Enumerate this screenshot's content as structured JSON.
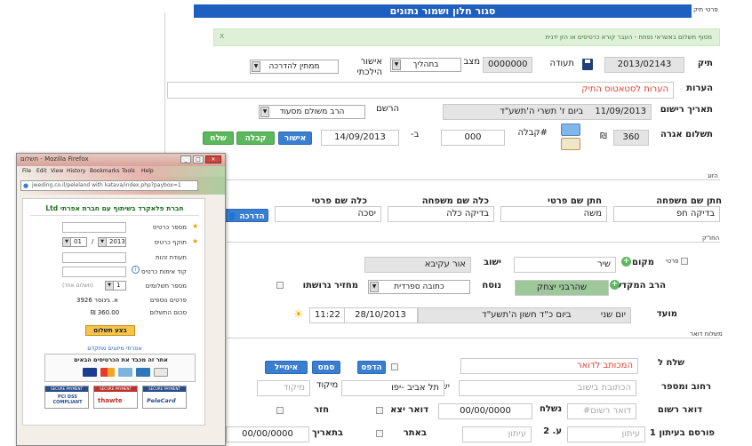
{
  "header": {
    "close_save_button": "סגור חלון ושמור נתונים"
  },
  "sections": {
    "file_details": "פרטי תיק",
    "hazmana": "הזוג",
    "hupa": "החו\"ק",
    "delivery": "משלוח דואר"
  },
  "notice": {
    "text": "מסוף תשלום באשראי נפתח - העבר קורא כרטיסים או הזן ידנית",
    "close": "x"
  },
  "file": {
    "tik_label": "תיק",
    "tik_value": "2013/02143",
    "teuda_label": "תעודה",
    "teuda_value": "0000000",
    "matzav_label": "מצב",
    "matzav_value": "בתהליך",
    "ishur_label": "אישור הילכתי",
    "ishur_value": "ממתין להדרכה",
    "notes_label": "הערות",
    "notes_value": "הערות לסטאטוס התיק",
    "reg_date_label": "תאריך רישום",
    "reg_date_value": "11/09/2013",
    "reg_date_hebrew": "ביום ז' תשרי ה'תשע\"ד",
    "registrar_label": "הרשם",
    "registrar_value": "הרב משולם מסעוד",
    "fee_label": "תשלום אגרה",
    "fee_value": "360",
    "currency": "₪",
    "receipt_label": "#קבלה",
    "receipt_value": "000",
    "on_label": "ב-",
    "on_value": "14/09/2013",
    "approve_button": "אישור",
    "receipt_button": "קבלה",
    "pay_button": "שלח"
  },
  "couple": {
    "groom_last_label": "חתן שם משפחה",
    "groom_last_value": "בדיקה חפ",
    "groom_first_label": "חתן שם פרטי",
    "groom_first_value": "משה",
    "bride_last_label": "כלה שם משפחה",
    "bride_last_value": "בדיקה כלה",
    "bride_first_label": "כלה שם פרטי",
    "bride_first_value": "יסכה",
    "guidance_button": "הדרכה"
  },
  "hupa": {
    "place_label": "מקום",
    "place_value": "שיר",
    "private_label": "פרטי",
    "settlement_label": "ישוב",
    "settlement_value": "אור עקיבא",
    "rabbi_label": "הרב המקדש",
    "rabbi_value": "שהרבני יצחק",
    "nusach_label": "נוסח",
    "nusach_value": "כתובה ספרדית",
    "divorcees_label": "מחזיר גרושתו",
    "date_label": "מועד",
    "day_value": "יום שני",
    "hebrew_date": "ביום כ\"ד חשון ה'תשע\"ד",
    "date_value": "28/10/2013",
    "time_value": "11:22"
  },
  "delivery": {
    "send_to_label": "שלח ל",
    "send_to_value": "המכותב לדואר",
    "print_button": "הדפס",
    "sms_button": "סמס",
    "email_button": "אימייל",
    "street_label": "רחוב ומספר",
    "street_placeholder": "הכתובת בישוב",
    "settlement_label": "ישוב",
    "settlement_value": "תל אביב -יפו",
    "zip_label": "מיקוד",
    "zip_placeholder": "מיקוד",
    "registered_label": "דואר רשום",
    "registered_placeholder": "דואר רשום#",
    "sent_label": "נשלח",
    "sent_value": "00/00/0000",
    "outgoing_label": "דואר יצא",
    "returned_label": "חזר",
    "published_label": "פורסם בעיתון 1",
    "newspaper_placeholder": "עיתון",
    "page_label": "ע. 2",
    "page_placeholder": "עיתון",
    "site_label": "באתר",
    "date_label": "בתאריך",
    "date_value": "00/00/0000"
  },
  "popup": {
    "window_title": "תשלום - Mozilla Firefox",
    "menu": [
      "File",
      "Edit",
      "View",
      "History",
      "Bookmarks",
      "Tools",
      "Help"
    ],
    "url": "jweding.co.il/peleland with katava/index.php?paybox=1",
    "company": "חברת פלאקרד בשיתוף עם חברת אפרתי Ltd",
    "card_number_label": "מספר כרטיס",
    "expiry_label": "תוקף כרטיס",
    "expiry_month": "01",
    "expiry_year": "2013",
    "expiry_sep": "/",
    "id_label": "תעודת זהות",
    "cvv_label": "קוד אימות כרטיס",
    "payments_label": "מספר תשלומים",
    "payments_value": "1",
    "payments_note": "(תשלום אחד)",
    "customer_label": "פרטים נוספים",
    "customer_value": "א. גינוסר 3926",
    "amount_label": "סכום התשלום",
    "amount_value": "₪ 360.00",
    "pay_button": "בצע תשלום",
    "advanced_link": "אפרתי מיזוגים מתקדם",
    "cards_heading": "אתר זה מכבד את הכרטיסים הבאים",
    "secure_badges": [
      "SECURE PAYMENT",
      "SECURE PAYMENT",
      "SECURE PAYMENT"
    ],
    "pci_text": "PCI DSS COMPLIANT",
    "thawte_text": "thawte",
    "pelecard_text": "PeleCard"
  },
  "colors": {
    "header_blue": "#1f5fbf",
    "btn_green": "#5cb85c",
    "btn_blue": "#3a7ed1",
    "notice_bg": "#dff0d8",
    "red_text": "#e2412e",
    "rabbi_bg": "#9ec89a"
  }
}
